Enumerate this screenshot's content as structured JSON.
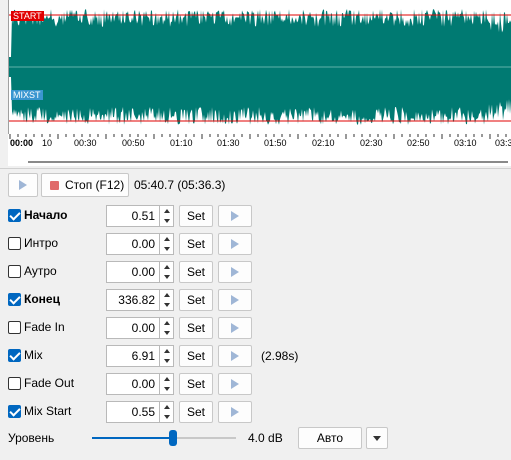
{
  "waveform": {
    "start_marker": "START",
    "mix_marker": "MIXST",
    "wave_color": "#007a72",
    "start_marker_color": "#e00000",
    "mix_marker_color": "#3a96d0"
  },
  "timeline": {
    "labels": [
      "00:00",
      "10",
      "00:30",
      "00:50",
      "01:10",
      "01:30",
      "01:50",
      "02:10",
      "02:30",
      "02:50",
      "03:10",
      "03:3"
    ]
  },
  "transport": {
    "stop_label": "Стоп (F12)",
    "time": "05:40.7 (05:36.3)"
  },
  "rows": [
    {
      "label": "Начало",
      "value": "0.51",
      "checked": true,
      "bold": true,
      "note": ""
    },
    {
      "label": "Интро",
      "value": "0.00",
      "checked": false,
      "bold": false,
      "note": ""
    },
    {
      "label": "Аутро",
      "value": "0.00",
      "checked": false,
      "bold": false,
      "note": ""
    },
    {
      "label": "Конец",
      "value": "336.82",
      "checked": true,
      "bold": true,
      "note": ""
    },
    {
      "label": "Fade In",
      "value": "0.00",
      "checked": false,
      "bold": false,
      "note": ""
    },
    {
      "label": "Mix",
      "value": "6.91",
      "checked": true,
      "bold": false,
      "note": "(2.98s)"
    },
    {
      "label": "Fade Out",
      "value": "0.00",
      "checked": false,
      "bold": false,
      "note": ""
    },
    {
      "label": "Mix Start",
      "value": "0.55",
      "checked": true,
      "bold": false,
      "note": ""
    }
  ],
  "set_label": "Set",
  "level": {
    "label": "Уровень",
    "value": "4.0 dB",
    "slider_fraction": 0.56,
    "auto_label": "Авто"
  }
}
